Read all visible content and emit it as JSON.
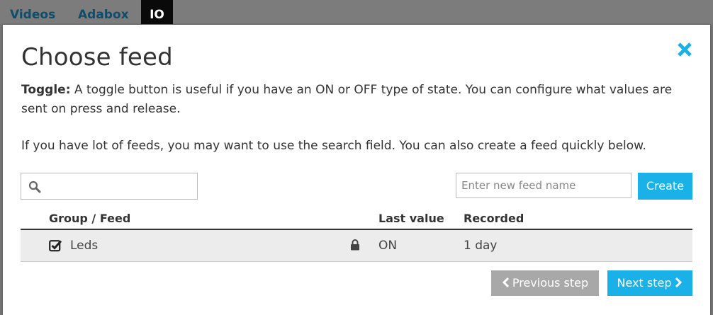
{
  "topnav": {
    "items": [
      {
        "label": "Videos"
      },
      {
        "label": "Adabox"
      },
      {
        "label": "IO",
        "active": true
      }
    ]
  },
  "modal": {
    "title": "Choose feed",
    "close_icon": "close-icon",
    "description_bold": "Toggle:",
    "description": " A toggle button is useful if you have an ON or OFF type of state. You can configure what values are sent on press and release.",
    "hint": "If you have lot of feeds, you may want to use the search field. You can also create a feed quickly below.",
    "search": {
      "value": "",
      "icon": "search-icon"
    },
    "new_feed": {
      "placeholder": "Enter new feed name",
      "value": ""
    },
    "create_label": "Create",
    "table": {
      "headers": {
        "feed": "Group / Feed",
        "last_value": "Last value",
        "recorded": "Recorded"
      },
      "rows": [
        {
          "checked": true,
          "name": "Leds",
          "locked": true,
          "last_value": "ON",
          "recorded": "1 day"
        }
      ]
    },
    "prev_label": "Previous step",
    "next_label": "Next step"
  },
  "colors": {
    "accent": "#1ab0e8",
    "prev_button": "#a8a8a8",
    "nav_text": "#0f4d6b",
    "row_background": "#ececec"
  }
}
